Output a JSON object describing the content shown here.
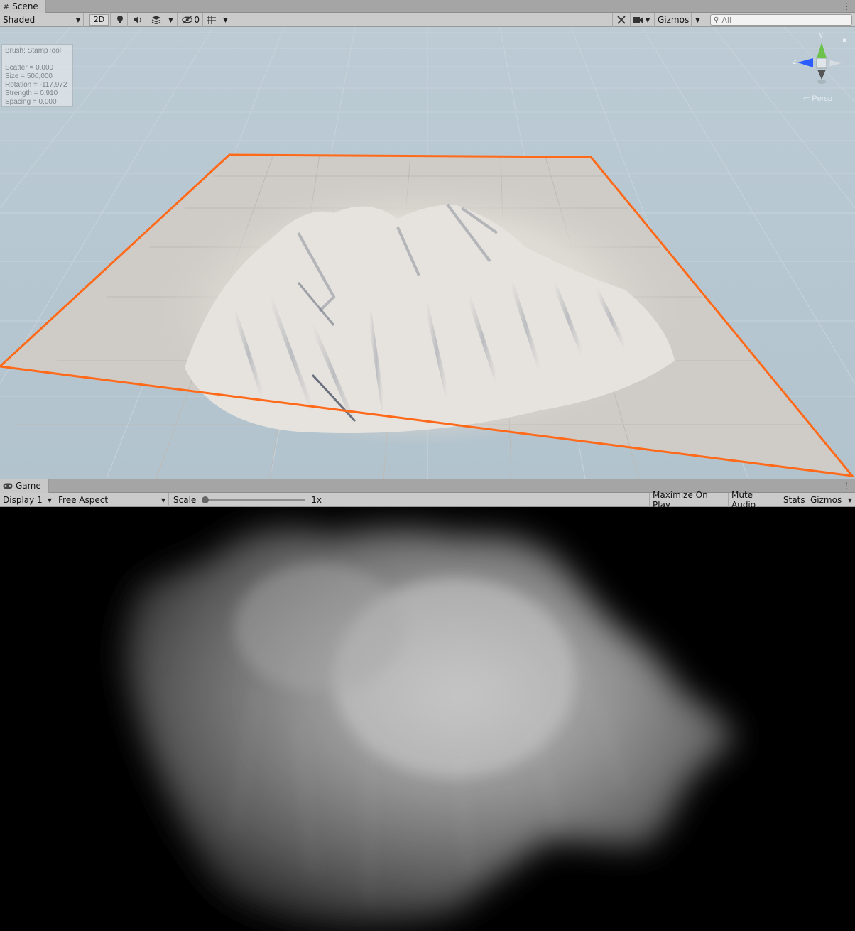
{
  "scene_panel": {
    "tab_label": "Scene",
    "shading_mode": "Shaded",
    "mode_2d_label": "2D",
    "hidden_count": "0",
    "gizmos_label": "Gizmos",
    "search_placeholder": "All",
    "brush_info": {
      "title": "Brush: StampTool",
      "scatter": "Scatter = 0,000",
      "size": "Size = 500,000",
      "rotation": "Rotation = -117,972",
      "strength": "Strength = 0,910",
      "spacing": "Spacing = 0,000"
    },
    "orientation_gizmo": {
      "y_label": "y",
      "z_label": "z",
      "projection_label": "Persp"
    },
    "colors": {
      "terrain_outline": "#ff6a1a",
      "sky": "#b8c8d2",
      "terrain": "#cfccc7"
    }
  },
  "game_panel": {
    "tab_label": "Game",
    "display_label": "Display 1",
    "aspect_label": "Free Aspect",
    "scale_label": "Scale",
    "scale_value": "1x",
    "maximize_on_play_label": "Maximize On Play",
    "mute_audio_label": "Mute Audio",
    "stats_label": "Stats",
    "gizmos_label": "Gizmos"
  },
  "icons": [
    "scene-tab-icon",
    "lighting-icon",
    "audio-icon",
    "effects-icon",
    "visibility-icon",
    "grid-snap-icon",
    "tools-icon",
    "camera-icon",
    "search-icon",
    "game-tab-icon",
    "more-menu-icon",
    "orientation-gizmo-icon"
  ]
}
